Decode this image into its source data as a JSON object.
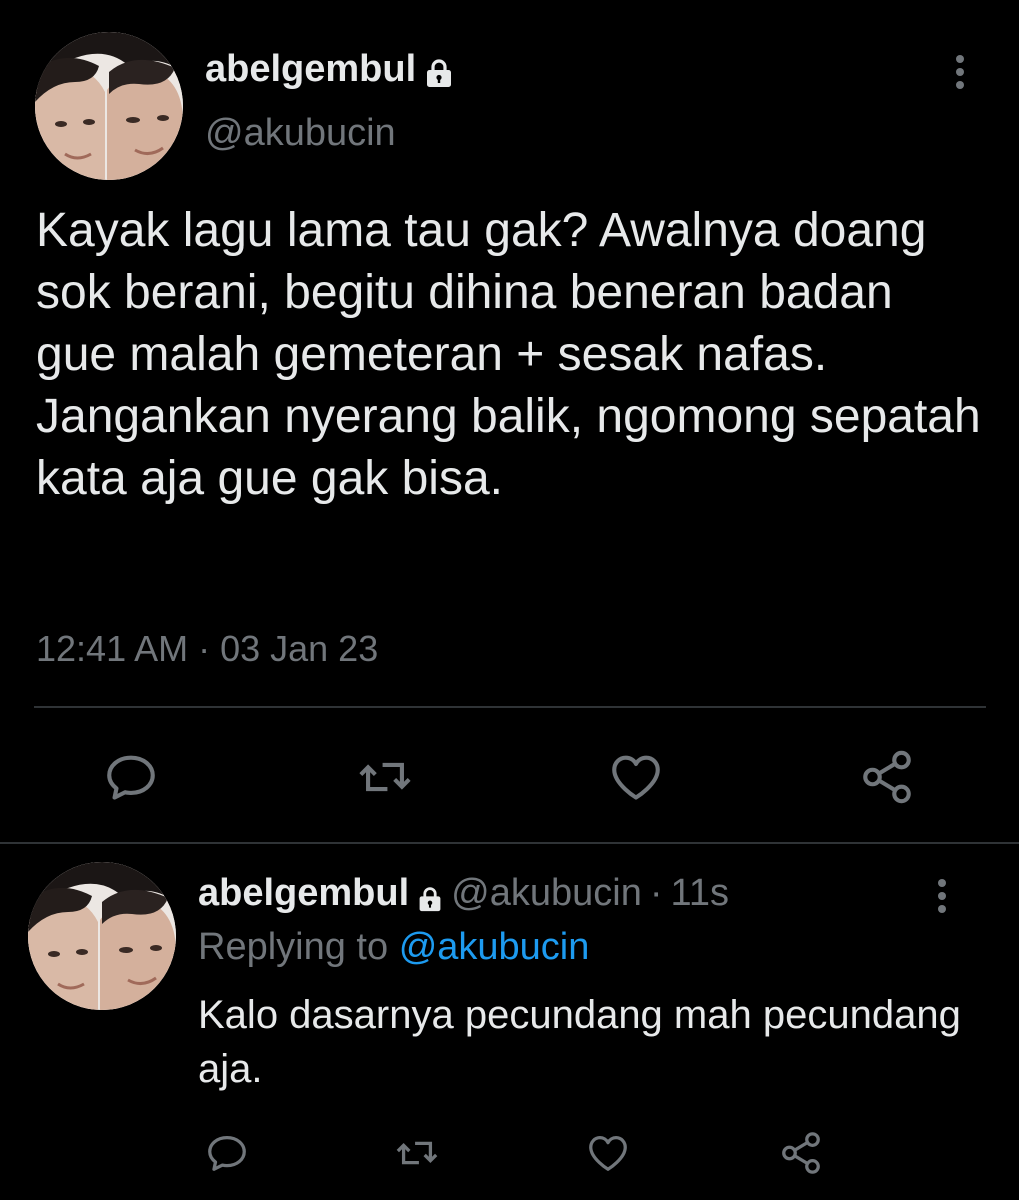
{
  "colors": {
    "background": "#000000",
    "text_primary": "#e7e9ea",
    "text_secondary": "#71767b",
    "accent": "#1d9bf0",
    "divider": "#2f3336"
  },
  "main_tweet": {
    "display_name": "abelgembul",
    "handle": "@akubucin",
    "text": "Kayak lagu lama tau gak? Awalnya doang sok berani, begitu dihina beneran badan gue malah gemeteran + sesak nafas. Jangankan nyerang balik, ngomong sepatah kata aja gue gak bisa.",
    "timestamp": "12:41 AM · 03 Jan 23",
    "icons": {
      "lock": "lock-icon",
      "more": "more-vertical-icon",
      "reply": "reply-icon",
      "retweet": "retweet-icon",
      "like": "heart-icon",
      "share": "share-icon"
    }
  },
  "reply_tweet": {
    "display_name": "abelgembul",
    "handle": "@akubucin",
    "separator": "·",
    "age": "11s",
    "replying_prefix": "Replying to",
    "replying_to": "@akubucin",
    "text": "Kalo dasarnya pecundang mah pecundang aja.",
    "icons": {
      "lock": "lock-icon",
      "more": "more-vertical-icon",
      "reply": "reply-icon",
      "retweet": "retweet-icon",
      "like": "heart-icon",
      "share": "share-icon"
    }
  }
}
